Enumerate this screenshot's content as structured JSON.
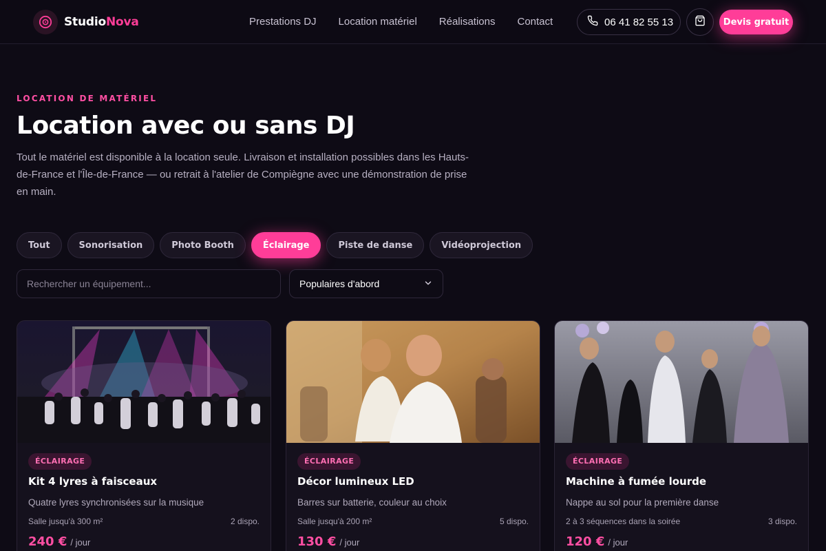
{
  "brand": {
    "name_part1": "Studio",
    "name_part2": "Nova",
    "accent": "#ff3d98",
    "icon": "vinyl-record-icon"
  },
  "nav": {
    "items": [
      "Prestations DJ",
      "Location matériel",
      "Réalisations",
      "Contact"
    ]
  },
  "header": {
    "phone": "06 41 82 55 13",
    "phone_icon": "phone-icon",
    "cart_icon": "shopping-bag-icon",
    "cta_label": "Devis gratuit"
  },
  "hero": {
    "eyebrow": "LOCATION DE MATÉRIEL",
    "title": "Location avec ou sans DJ",
    "description": "Tout le matériel est disponible à la location seule. Livraison et installation possibles dans les Hauts-de-France et l'Île-de-France — ou retrait à l'atelier de Compiègne avec une démonstration de prise en main."
  },
  "filters": {
    "chips": [
      "Tout",
      "Sonorisation",
      "Photo Booth",
      "Éclairage",
      "Piste de danse",
      "Vidéoprojection"
    ],
    "active_index": 3,
    "search_placeholder": "Rechercher un équipement...",
    "sort_selected": "Populaires d'abord",
    "sort_icon": "chevron-down-icon"
  },
  "products": [
    {
      "category": "ÉCLAIRAGE",
      "title": "Kit 4 lyres à faisceaux",
      "subtitle": "Quatre lyres synchronisées sur la musique",
      "capacity": "Salle jusqu'à 300 m²",
      "stock": "2 dispo.",
      "price": "240 €",
      "unit": "/ jour"
    },
    {
      "category": "ÉCLAIRAGE",
      "title": "Décor lumineux LED",
      "subtitle": "Barres sur batterie, couleur au choix",
      "capacity": "Salle jusqu'à 200 m²",
      "stock": "5 dispo.",
      "price": "130 €",
      "unit": "/ jour"
    },
    {
      "category": "ÉCLAIRAGE",
      "title": "Machine à fumée lourde",
      "subtitle": "Nappe au sol pour la première danse",
      "capacity": "2 à 3 séquences dans la soirée",
      "stock": "3 dispo.",
      "price": "120 €",
      "unit": "/ jour"
    }
  ]
}
